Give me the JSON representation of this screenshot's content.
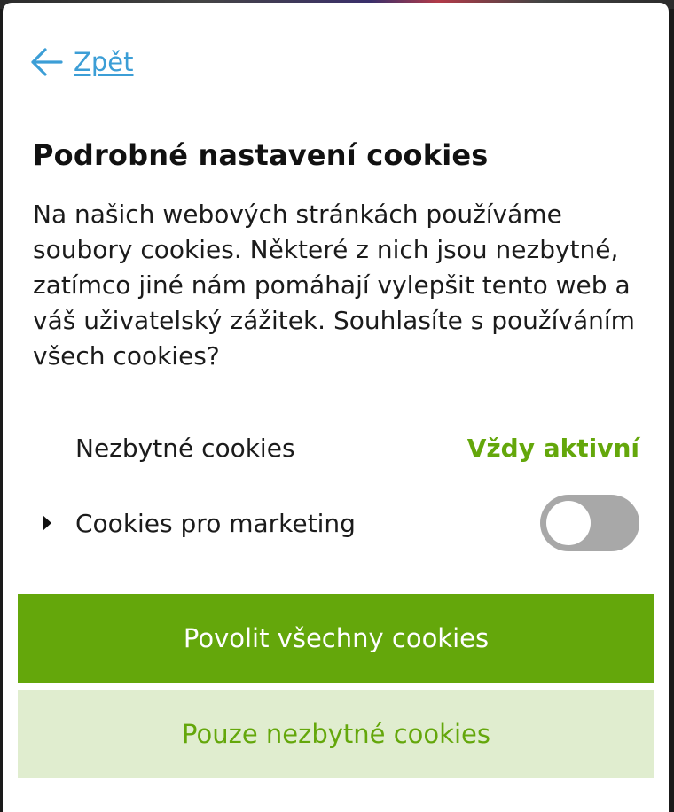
{
  "header": {
    "back_label": "Zpět"
  },
  "dialog": {
    "title": "Podrobné nastavení cookies",
    "description": "Na našich webových stránkách používáme soubory cookies. Některé z nich jsou nezbytné, zatímco jiné nám pomáhají vylepšit tento web a váš uživatelský zážitek. Souhlasíte s používáním všech cookies?"
  },
  "categories": [
    {
      "label": "Nezbytné cookies",
      "status": "Vždy aktivní"
    },
    {
      "label": "Cookies pro marketing",
      "enabled": false,
      "icon": "caret-right-icon"
    }
  ],
  "buttons": {
    "allow_all": "Povolit všechny cookies",
    "necessary_only": "Pouze nezbytné cookies"
  },
  "colors": {
    "accent_green": "#64a70b",
    "light_green": "#e0edcf",
    "link_blue": "#3c9ed6",
    "toggle_off": "#a8a8a8"
  }
}
